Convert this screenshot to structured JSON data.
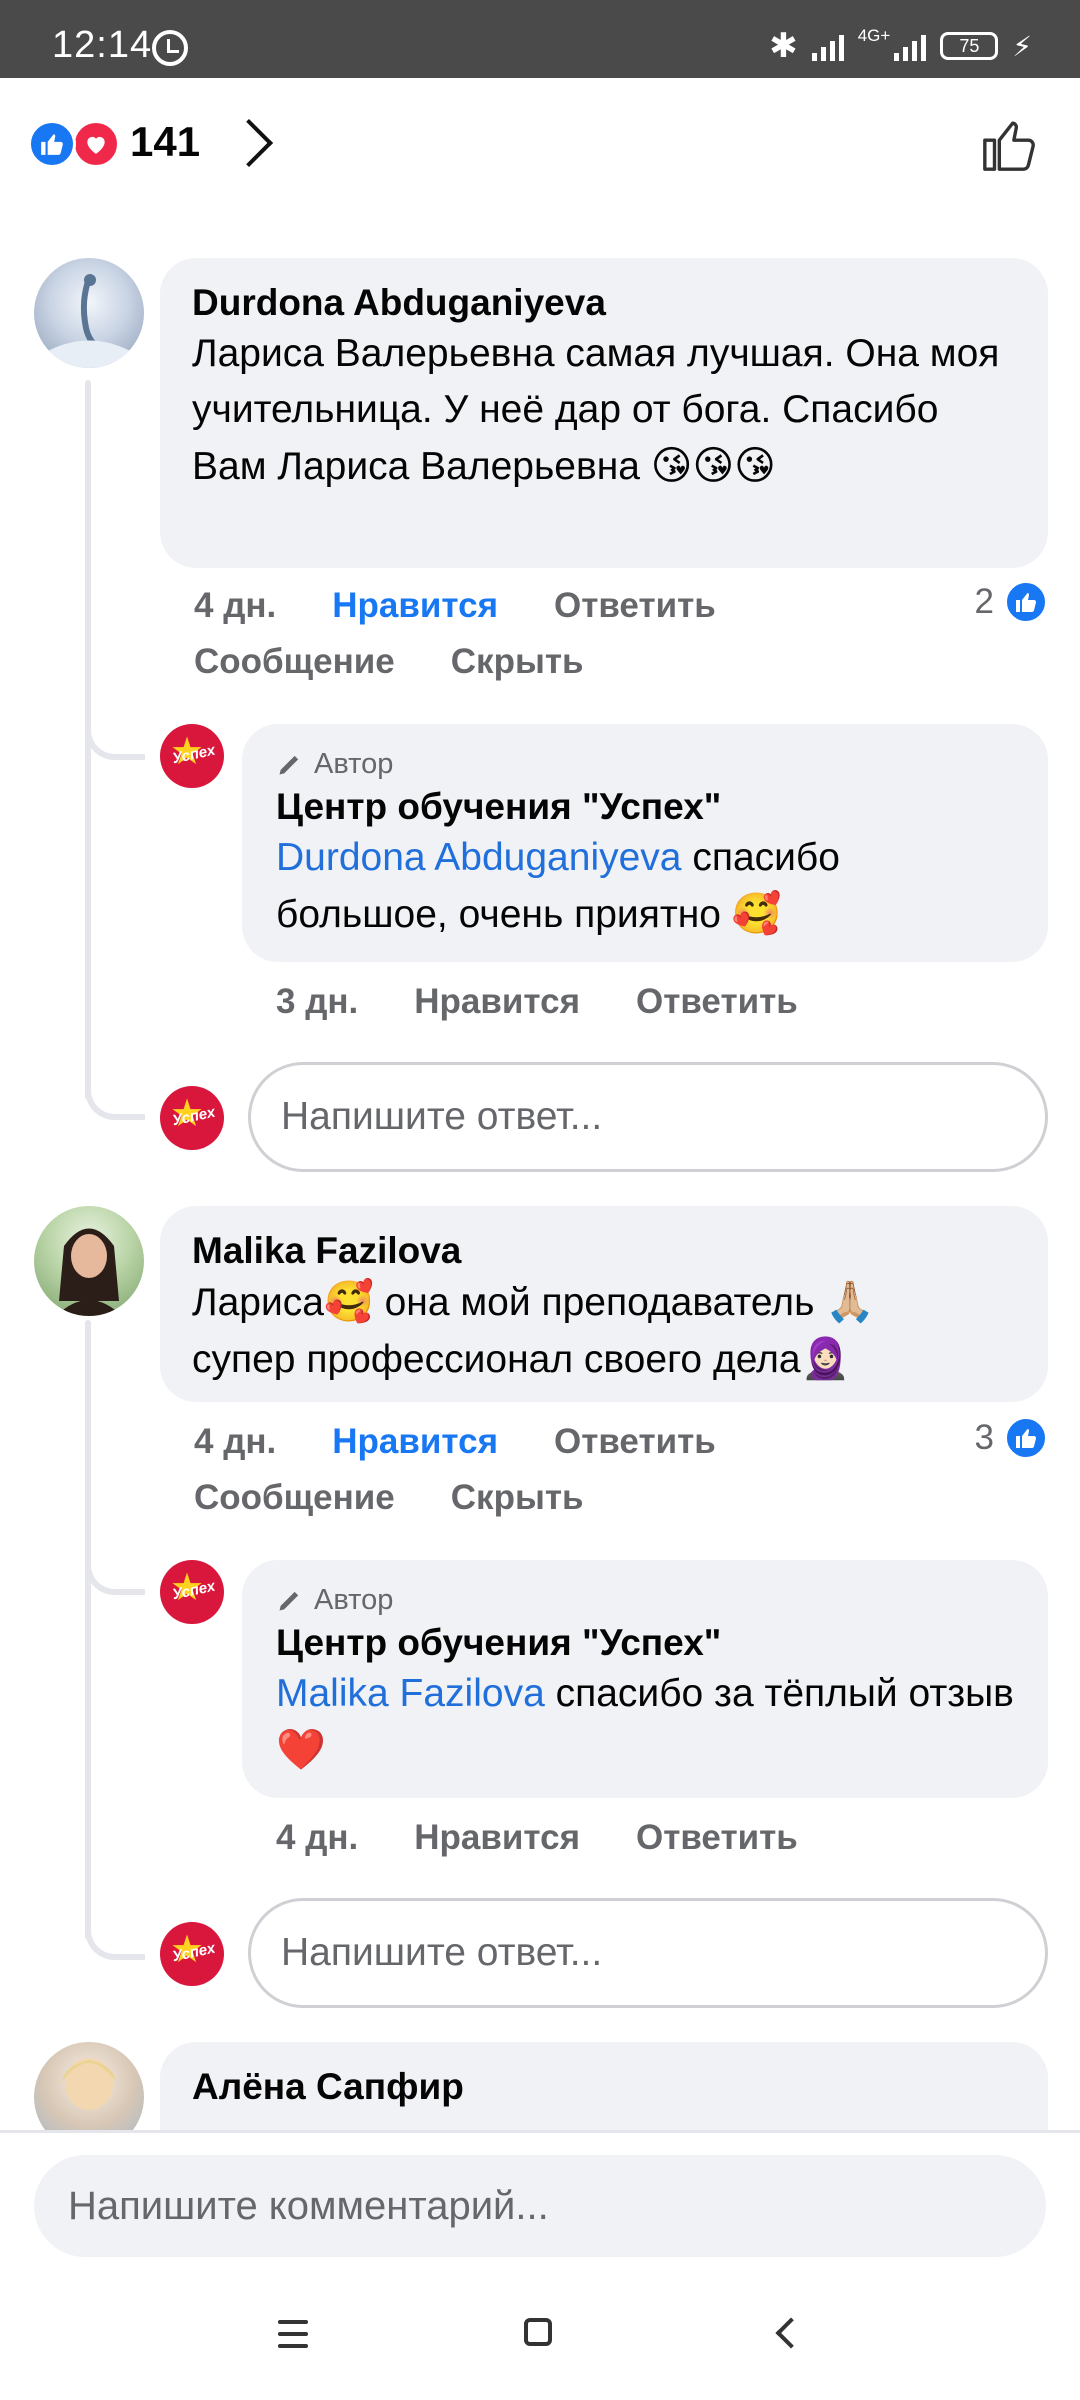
{
  "status": {
    "time": "12:14",
    "network": "4G+",
    "battery": "75"
  },
  "header": {
    "reaction_count": "141",
    "reactions": [
      "like-icon",
      "love-icon"
    ]
  },
  "comments": [
    {
      "author": "Durdona Abduganiyeva",
      "text": "Лариса Валерьевна самая лучшая. Она моя учительница. У неё дар от бога. Спасибо Вам Лариса Валерьевна",
      "emojis": "😘😘😘",
      "time": "4 дн.",
      "like": "Нравится",
      "reply": "Ответить",
      "message": "Сообщение",
      "hide": "Скрыть",
      "likes_count": "2",
      "reply_item": {
        "tag": "Автор",
        "author": "Центр обучения \"Успех\"",
        "mention": "Durdona Abduganiyeva",
        "text": " спасибо большое, очень приятно",
        "emoji": "🥰",
        "time": "3 дн.",
        "like": "Нравится",
        "reply": "Ответить"
      },
      "reply_placeholder": "Напишите ответ..."
    },
    {
      "author": "Malika Fazilova",
      "text_a": "Лариса",
      "emoji_a": "🥰",
      "text_b": " она мой преподаватель ",
      "emoji_b": "🙏🏼",
      "text_c": "супер профессионал своего дела",
      "emoji_c": "🧕🏻",
      "time": "4 дн.",
      "like": "Нравится",
      "reply": "Ответить",
      "message": "Сообщение",
      "hide": "Скрыть",
      "likes_count": "3",
      "reply_item": {
        "tag": "Автор",
        "author": "Центр обучения \"Успех\"",
        "mention": "Malika Fazilova",
        "text": " спасибо за тёплый отзыв",
        "emoji": "❤️",
        "time": "4 дн.",
        "like": "Нравится",
        "reply": "Ответить"
      },
      "reply_placeholder": "Напишите ответ..."
    },
    {
      "author": "Алёна Сапфир"
    }
  ],
  "composer": {
    "placeholder": "Напишите комментарий..."
  },
  "colors": {
    "accent": "#1877f2",
    "bubble": "#f0f2f5",
    "muted": "#65676b",
    "mention": "#216fdb",
    "brand_red": "#d9163c"
  }
}
